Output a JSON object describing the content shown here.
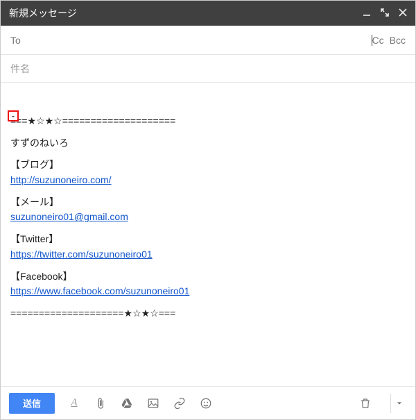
{
  "window": {
    "title": "新規メッセージ"
  },
  "recipients": {
    "to_label": "To",
    "to_value": "",
    "cc_label": "Cc",
    "bcc_label": "Bcc"
  },
  "subject": {
    "placeholder": "件名",
    "value": ""
  },
  "signature": {
    "sep_top": "===★☆★☆====================",
    "name": "すずのねいろ",
    "blog_heading": "【ブログ】",
    "blog_url": "http://suzunoneiro.com/",
    "mail_heading": "【メール】",
    "mail_address": "suzunoneiro01@gmail.com",
    "twitter_heading": "【Twitter】",
    "twitter_url": "https://twitter.com/suzunoneiro01",
    "facebook_heading": "【Facebook】",
    "facebook_url": "https://www.facebook.com/suzunoneiro01",
    "sep_bottom": "====================★☆★☆==="
  },
  "toolbar": {
    "send_label": "送信"
  }
}
